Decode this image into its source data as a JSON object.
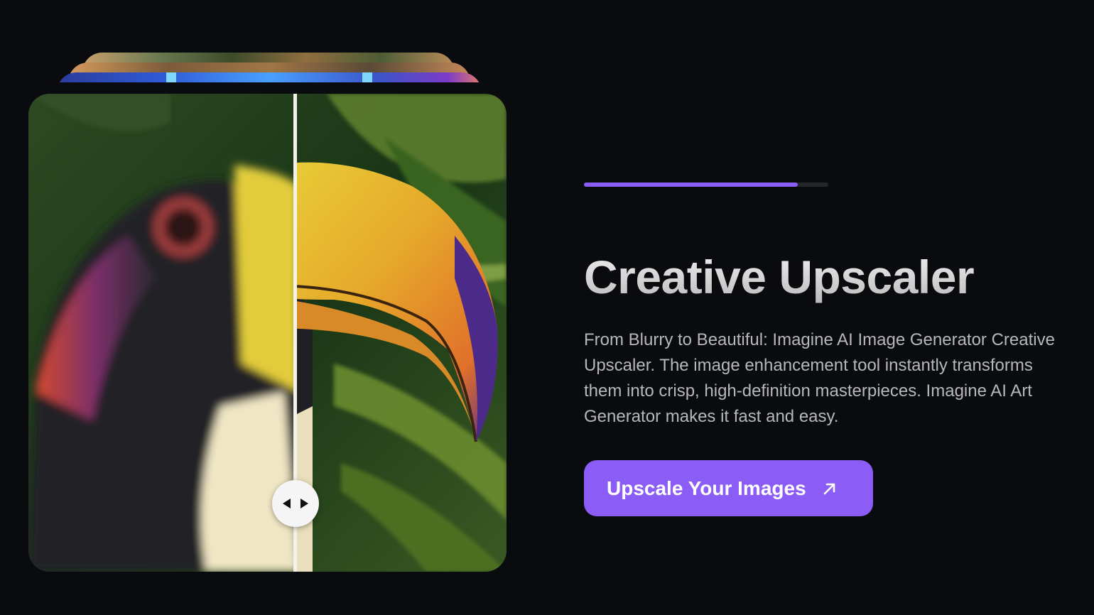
{
  "hero": {
    "progress_percent": 87.5,
    "title": "Creative Upscaler",
    "description": "From Blurry to Beautiful: Imagine AI Image Generator Creative Upscaler. The image enhancement tool instantly transforms them into crisp, high-definition masterpieces. Imagine AI Art Generator makes it fast and easy.",
    "cta_label": "Upscale Your Images",
    "cta_icon": "arrow-up-right-icon"
  },
  "comparison": {
    "left_state": "blurry",
    "right_state": "sharp",
    "slider_position_percent": 55.8,
    "handle_icon": "left-right-arrows-icon"
  },
  "colors": {
    "background": "#0a0b0e",
    "accent": "#8b5cf6",
    "progress_track": "#25262b",
    "text_body": "#b7b8bd"
  }
}
